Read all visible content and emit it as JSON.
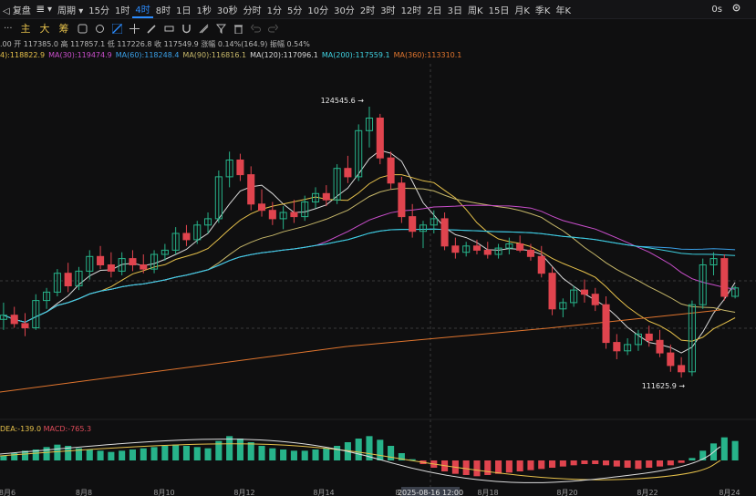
{
  "toolbar": {
    "back": "◁ 复盘",
    "chart_type": "𝌆 ▾",
    "period": "周期 ▾",
    "intervals": [
      "15分",
      "1时",
      "4时",
      "8时",
      "1日",
      "1秒",
      "30秒",
      "分时",
      "1分",
      "5分",
      "10分",
      "30分",
      "2时",
      "3时",
      "12时",
      "2日",
      "3日",
      "周K",
      "15日",
      "月K",
      "季K",
      "年K"
    ],
    "active_interval": "4时",
    "right_label": "0s",
    "settings_icon": "gear-icon"
  },
  "toolbar2": {
    "icons": [
      "more-icon",
      "indicator-icon",
      "drawing-icon",
      "crosshair-icon",
      "pencil-icon",
      "ruler-icon",
      "magnet-icon",
      "measure-icon",
      "filter-icon",
      "delete-icon",
      "undo-icon",
      "redo-icon"
    ],
    "chinese_labels": [
      "主",
      "大",
      "筹"
    ]
  },
  "stats": {
    "text": ".00 开 117385.0 高 117857.1 低 117226.8 收 117549.9 涨幅 0.14%(164.9) 振幅 0.54%"
  },
  "ma_indicators": [
    {
      "label": "4):118822.9",
      "color": "#e6c14b"
    },
    {
      "label": "MA(30):119474.9",
      "color": "#c94ecb"
    },
    {
      "label": "MA(60):118248.4",
      "color": "#3aa0e8"
    },
    {
      "label": "MA(90):116816.1",
      "color": "#c7b86a"
    },
    {
      "label": "MA(120):117096.1",
      "color": "#d9d9d9"
    },
    {
      "label": "MA(200):117559.1",
      "color": "#3fd1e0"
    },
    {
      "label": "MA(360):113310.1",
      "color": "#e0752e"
    }
  ],
  "annotations": {
    "high_label": "124545.6 →",
    "low_label": "111625.9 →",
    "crosshair_time": "2025-08-16 12:00"
  },
  "macd": {
    "dea_label": "DEA:-139.0",
    "macd_label": "MACD:-765.3",
    "dea_color": "#e6c14b",
    "macd_color": "#e04c5a"
  },
  "x_axis": [
    "8月6",
    "8月8",
    "8月10",
    "8月12",
    "8月14",
    "8月16",
    "8月18",
    "8月20",
    "8月22",
    "8月24"
  ],
  "colors": {
    "up": "#27b38a",
    "down": "#e0444e",
    "background": "#0f0f10",
    "accent": "#2b8cff"
  },
  "chart_data": {
    "type": "candlestick",
    "symbol_period": "4时",
    "high_marked": 124545.6,
    "low_marked": 111625.9,
    "ylim": [
      110500,
      126500
    ],
    "candles": [
      {
        "o": 114400,
        "h": 115200,
        "l": 113900,
        "c": 114600
      },
      {
        "o": 114600,
        "h": 115000,
        "l": 114000,
        "c": 114200
      },
      {
        "o": 114200,
        "h": 114700,
        "l": 113600,
        "c": 114000
      },
      {
        "o": 114000,
        "h": 115600,
        "l": 113900,
        "c": 115300
      },
      {
        "o": 115300,
        "h": 115900,
        "l": 114900,
        "c": 115700
      },
      {
        "o": 115700,
        "h": 116800,
        "l": 115500,
        "c": 116600
      },
      {
        "o": 116600,
        "h": 117100,
        "l": 115700,
        "c": 116000
      },
      {
        "o": 116000,
        "h": 116900,
        "l": 115800,
        "c": 116700
      },
      {
        "o": 116700,
        "h": 117700,
        "l": 116300,
        "c": 117400
      },
      {
        "o": 117400,
        "h": 117900,
        "l": 116800,
        "c": 117000
      },
      {
        "o": 117000,
        "h": 117600,
        "l": 116400,
        "c": 116700
      },
      {
        "o": 116700,
        "h": 117600,
        "l": 116500,
        "c": 117300
      },
      {
        "o": 117300,
        "h": 117700,
        "l": 116700,
        "c": 117000
      },
      {
        "o": 117000,
        "h": 117500,
        "l": 116600,
        "c": 116800
      },
      {
        "o": 116800,
        "h": 117700,
        "l": 116600,
        "c": 117500
      },
      {
        "o": 117500,
        "h": 118000,
        "l": 117200,
        "c": 117700
      },
      {
        "o": 117700,
        "h": 118800,
        "l": 117500,
        "c": 118500
      },
      {
        "o": 118500,
        "h": 118900,
        "l": 117900,
        "c": 118200
      },
      {
        "o": 118200,
        "h": 119100,
        "l": 118000,
        "c": 118900
      },
      {
        "o": 118900,
        "h": 119500,
        "l": 118500,
        "c": 119200
      },
      {
        "o": 119200,
        "h": 121500,
        "l": 119000,
        "c": 121200
      },
      {
        "o": 121200,
        "h": 122400,
        "l": 120700,
        "c": 122000
      },
      {
        "o": 122000,
        "h": 122300,
        "l": 121000,
        "c": 121300
      },
      {
        "o": 121300,
        "h": 121700,
        "l": 119600,
        "c": 119900
      },
      {
        "o": 119900,
        "h": 120600,
        "l": 119300,
        "c": 119600
      },
      {
        "o": 119600,
        "h": 120000,
        "l": 118900,
        "c": 119200
      },
      {
        "o": 119200,
        "h": 119800,
        "l": 118700,
        "c": 119500
      },
      {
        "o": 119500,
        "h": 120100,
        "l": 119000,
        "c": 119300
      },
      {
        "o": 119300,
        "h": 120300,
        "l": 119100,
        "c": 120000
      },
      {
        "o": 120000,
        "h": 120700,
        "l": 119700,
        "c": 120400
      },
      {
        "o": 120400,
        "h": 120800,
        "l": 119800,
        "c": 120100
      },
      {
        "o": 120100,
        "h": 121800,
        "l": 119900,
        "c": 121600
      },
      {
        "o": 121600,
        "h": 122200,
        "l": 120900,
        "c": 121200
      },
      {
        "o": 121200,
        "h": 123700,
        "l": 121000,
        "c": 123400
      },
      {
        "o": 123400,
        "h": 124545.6,
        "l": 122600,
        "c": 124000
      },
      {
        "o": 124000,
        "h": 124200,
        "l": 121800,
        "c": 122100
      },
      {
        "o": 122100,
        "h": 122400,
        "l": 120600,
        "c": 120900
      },
      {
        "o": 120900,
        "h": 121200,
        "l": 119000,
        "c": 119300
      },
      {
        "o": 119300,
        "h": 119900,
        "l": 118300,
        "c": 118600
      },
      {
        "o": 118600,
        "h": 119100,
        "l": 117800,
        "c": 118900
      },
      {
        "o": 118900,
        "h": 119600,
        "l": 118500,
        "c": 119200
      },
      {
        "o": 119200,
        "h": 119500,
        "l": 117700,
        "c": 117900
      },
      {
        "o": 117900,
        "h": 118300,
        "l": 117300,
        "c": 117600
      },
      {
        "o": 117600,
        "h": 118100,
        "l": 117400,
        "c": 117900
      },
      {
        "o": 117900,
        "h": 118200,
        "l": 117500,
        "c": 117700
      },
      {
        "o": 117700,
        "h": 118100,
        "l": 117300,
        "c": 117500
      },
      {
        "o": 117500,
        "h": 118000,
        "l": 117300,
        "c": 117800
      },
      {
        "o": 117800,
        "h": 118300,
        "l": 117500,
        "c": 118000
      },
      {
        "o": 118000,
        "h": 118400,
        "l": 117600,
        "c": 117700
      },
      {
        "o": 117700,
        "h": 118000,
        "l": 117200,
        "c": 117400
      },
      {
        "o": 117400,
        "h": 117900,
        "l": 116400,
        "c": 116600
      },
      {
        "o": 116600,
        "h": 116900,
        "l": 114600,
        "c": 114900
      },
      {
        "o": 114900,
        "h": 115400,
        "l": 114500,
        "c": 115200
      },
      {
        "o": 115200,
        "h": 116000,
        "l": 115000,
        "c": 115800
      },
      {
        "o": 115800,
        "h": 116300,
        "l": 115200,
        "c": 115600
      },
      {
        "o": 115600,
        "h": 115900,
        "l": 114800,
        "c": 115100
      },
      {
        "o": 115100,
        "h": 115500,
        "l": 113000,
        "c": 113300
      },
      {
        "o": 113300,
        "h": 113700,
        "l": 112500,
        "c": 112900
      },
      {
        "o": 112900,
        "h": 113500,
        "l": 112700,
        "c": 113200
      },
      {
        "o": 113200,
        "h": 113900,
        "l": 112900,
        "c": 113700
      },
      {
        "o": 113700,
        "h": 114100,
        "l": 113100,
        "c": 113400
      },
      {
        "o": 113400,
        "h": 113900,
        "l": 112600,
        "c": 112800
      },
      {
        "o": 112800,
        "h": 113200,
        "l": 111900,
        "c": 112200
      },
      {
        "o": 112200,
        "h": 112600,
        "l": 111625.9,
        "c": 111900
      },
      {
        "o": 111900,
        "h": 115300,
        "l": 111700,
        "c": 115100
      },
      {
        "o": 115100,
        "h": 117300,
        "l": 114900,
        "c": 117000
      },
      {
        "o": 117000,
        "h": 117600,
        "l": 116500,
        "c": 117300
      },
      {
        "o": 117300,
        "h": 117500,
        "l": 115300,
        "c": 115500
      },
      {
        "o": 115500,
        "h": 116000,
        "l": 115400,
        "c": 115900
      }
    ],
    "macd_hist": [
      40,
      60,
      80,
      90,
      110,
      130,
      120,
      100,
      90,
      80,
      70,
      80,
      90,
      100,
      110,
      120,
      130,
      120,
      110,
      100,
      160,
      200,
      180,
      150,
      120,
      100,
      90,
      80,
      80,
      90,
      100,
      120,
      150,
      180,
      200,
      170,
      120,
      60,
      10,
      -30,
      -60,
      -90,
      -110,
      -120,
      -130,
      -120,
      -110,
      -100,
      -90,
      -80,
      -70,
      -60,
      -50,
      -40,
      -30,
      -30,
      -40,
      -50,
      -60,
      -70,
      -60,
      -50,
      -40,
      -20,
      20,
      80,
      140,
      190,
      160
    ],
    "macd_ylim": [
      -300,
      300
    ]
  }
}
